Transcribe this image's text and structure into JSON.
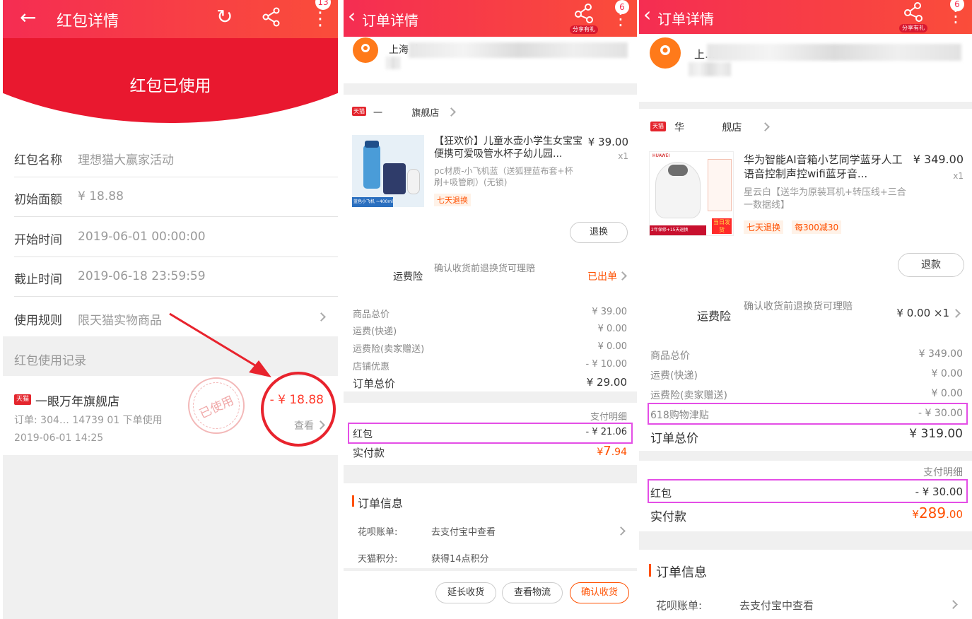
{
  "p1": {
    "title": "红包详情",
    "badge": "13",
    "status": "红包已使用",
    "fields": [
      {
        "label": "红包名称",
        "value": "理想猫大赢家活动"
      },
      {
        "label": "初始面额",
        "value": "¥ 18.88"
      },
      {
        "label": "开始时间",
        "value": "2019-06-01 00:00:00"
      },
      {
        "label": "截止时间",
        "value": "2019-06-18 23:59:59"
      },
      {
        "label": "使用规则",
        "value": "限天猫实物商品"
      }
    ],
    "records_title": "红包使用记录",
    "tmall_tag": "天猫",
    "store": "一眼万年旗舰店",
    "order": "订单: 304…  14739  01 下单使用",
    "date": "2019-06-01 14:25",
    "amount": "- ¥ 18.88",
    "view": "查看",
    "stamp": "已使用"
  },
  "p2": {
    "title": "订单详情",
    "badge": "6",
    "share_tag": "分享有礼",
    "address": "上海 上…",
    "tmall_tag": "天猫",
    "store_name": "一          旗舰店",
    "product_title": "【狂欢价】儿童水壶小学生女宝宝便携可爱吸管水杯子幼儿园...",
    "price": "¥ 39.00",
    "qty": "x1",
    "sku": "pc材质-小飞机蓝（送狐狸蓝布套+杯刷+吸管刷）(无锁)",
    "return_tag": "七天退换",
    "thumb_caption": "蓝色小飞机 ~400ml",
    "btn_return": "退换",
    "insurance_label": "运费险",
    "insurance_desc": "确认收货前退换货可理赔",
    "insurance_status": "已出单",
    "costs": [
      {
        "label": "商品总价",
        "value": "¥ 39.00"
      },
      {
        "label": "运费(快递)",
        "value": "¥ 0.00"
      },
      {
        "label": "运费险(卖家赠送)",
        "value": "¥ 0.00"
      },
      {
        "label": "店铺优惠",
        "value": "- ¥ 10.00"
      }
    ],
    "total_label": "订单总价",
    "total_value": "¥ 29.00",
    "pay_detail": "支付明细",
    "hongbao_label": "红包",
    "hongbao_value": "- ¥ 21.06",
    "paid_label": "实付款",
    "paid_yen": "¥",
    "paid_int": "7",
    "paid_dec": ".94",
    "info_title": "订单信息",
    "info": [
      {
        "label": "花呗账单:",
        "value": "去支付宝中查看"
      },
      {
        "label": "天猫积分:",
        "value": "获得14点积分"
      }
    ],
    "btn_extend": "延长收货",
    "btn_logistics": "查看物流",
    "btn_confirm": "确认收货"
  },
  "p3": {
    "title": "订单详情",
    "badge": "6",
    "share_tag": "分享有礼",
    "address": "上…",
    "tmall_tag": "天猫",
    "store_name": "华            舰店",
    "product_title": "华为智能AI音箱小艺同学蓝牙人工语音控制声控wifi蓝牙音...",
    "price": "¥ 349.00",
    "qty": "x1",
    "sku": "星云白【送华为原装耳机+转压线+三合一数据线】",
    "tags": [
      "七天退换",
      "每300减30"
    ],
    "thumb_brand": "HUAWEI",
    "thumb_caption": "2年保修+15天退换",
    "thumb_stamp": "当日发货",
    "btn_refund": "退款",
    "insurance_label": "运费险",
    "insurance_desc": "确认收货前退换货可理赔",
    "insurance_status": "¥ 0.00 ×1",
    "costs": [
      {
        "label": "商品总价",
        "value": "¥ 349.00"
      },
      {
        "label": "运费(快递)",
        "value": "¥ 0.00"
      },
      {
        "label": "运费险(卖家赠送)",
        "value": "¥ 0.00"
      },
      {
        "label": "618购物津贴",
        "value": "- ¥ 30.00"
      }
    ],
    "total_label": "订单总价",
    "total_value": "¥ 319.00",
    "pay_detail": "支付明细",
    "hongbao_label": "红包",
    "hongbao_value": "- ¥ 30.00",
    "paid_label": "实付款",
    "paid_yen": "¥",
    "paid_int": "289",
    "paid_dec": ".00",
    "info_title": "订单信息",
    "info": [
      {
        "label": "花呗账单:",
        "value": "去支付宝中查看"
      }
    ]
  },
  "colors": {
    "brand": "#f52d52",
    "price": "#ff5000",
    "highlight": "#e44ee6",
    "annotation": "#e8232d"
  }
}
